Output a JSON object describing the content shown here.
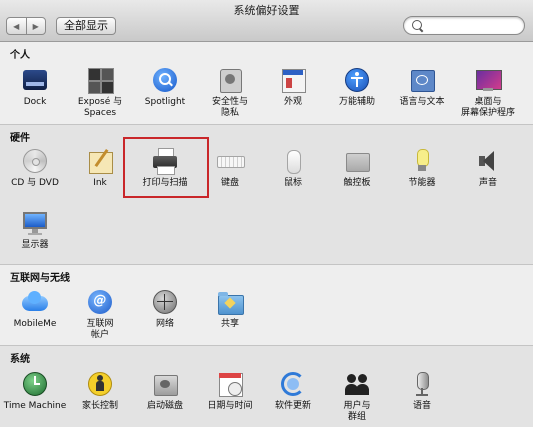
{
  "window": {
    "title": "系统偏好设置"
  },
  "toolbar": {
    "back_label": "◀",
    "forward_label": "▶",
    "show_all_label": "全部显示"
  },
  "search": {
    "value": "",
    "placeholder": ""
  },
  "sections": {
    "personal": {
      "title": "个人",
      "items": [
        {
          "label": "Dock",
          "icon": "dock-icon"
        },
        {
          "label": "Exposé 与\nSpaces",
          "icon": "expose-spaces-icon"
        },
        {
          "label": "Spotlight",
          "icon": "spotlight-icon"
        },
        {
          "label": "安全性与\n隐私",
          "icon": "security-privacy-icon"
        },
        {
          "label": "外观",
          "icon": "appearance-icon"
        },
        {
          "label": "万能辅助",
          "icon": "universal-access-icon"
        },
        {
          "label": "语言与文本",
          "icon": "language-text-icon"
        },
        {
          "label": "桌面与\n屏幕保护程序",
          "icon": "desktop-screensaver-icon"
        }
      ]
    },
    "hardware": {
      "title": "硬件",
      "items": [
        {
          "label": "CD 与 DVD",
          "icon": "cd-dvd-icon"
        },
        {
          "label": "Ink",
          "icon": "ink-icon"
        },
        {
          "label": "打印与扫描",
          "icon": "printer-icon"
        },
        {
          "label": "键盘",
          "icon": "keyboard-icon"
        },
        {
          "label": "鼠标",
          "icon": "mouse-icon"
        },
        {
          "label": "触控板",
          "icon": "trackpad-icon"
        },
        {
          "label": "节能器",
          "icon": "energy-saver-icon"
        },
        {
          "label": "声音",
          "icon": "sound-icon"
        },
        {
          "label": "显示器",
          "icon": "display-icon"
        }
      ]
    },
    "internet": {
      "title": "互联网与无线",
      "items": [
        {
          "label": "MobileMe",
          "icon": "mobileme-icon"
        },
        {
          "label": "互联网\n帐户",
          "icon": "internet-accounts-icon"
        },
        {
          "label": "网络",
          "icon": "network-icon"
        },
        {
          "label": "共享",
          "icon": "sharing-icon"
        }
      ]
    },
    "system": {
      "title": "系统",
      "items": [
        {
          "label": "Time Machine",
          "icon": "time-machine-icon"
        },
        {
          "label": "家长控制",
          "icon": "parental-controls-icon"
        },
        {
          "label": "启动磁盘",
          "icon": "startup-disk-icon"
        },
        {
          "label": "日期与时间",
          "icon": "date-time-icon"
        },
        {
          "label": "软件更新",
          "icon": "software-update-icon"
        },
        {
          "label": "用户与\n群组",
          "icon": "users-groups-icon"
        },
        {
          "label": "语音",
          "icon": "speech-icon"
        }
      ]
    }
  },
  "colors": {
    "highlight": "#c9262a",
    "accent": "#1e5fcf"
  }
}
